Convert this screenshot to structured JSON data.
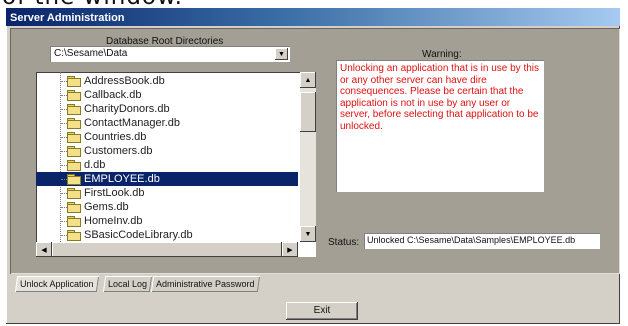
{
  "caption_overflow": "of the window.",
  "window": {
    "title": "Server Administration"
  },
  "db_roots": {
    "label": "Database Root Directories",
    "selected": "C:\\Sesame\\Data"
  },
  "tree": {
    "items": [
      {
        "label": "AddressBook.db",
        "selected": false
      },
      {
        "label": "Callback.db",
        "selected": false
      },
      {
        "label": "CharityDonors.db",
        "selected": false
      },
      {
        "label": "ContactManager.db",
        "selected": false
      },
      {
        "label": "Countries.db",
        "selected": false
      },
      {
        "label": "Customers.db",
        "selected": false
      },
      {
        "label": "d.db",
        "selected": false
      },
      {
        "label": "EMPLOYEE.db",
        "selected": true
      },
      {
        "label": "FirstLook.db",
        "selected": false
      },
      {
        "label": "Gems.db",
        "selected": false
      },
      {
        "label": "HomeInv.db",
        "selected": false
      },
      {
        "label": "SBasicCodeLibrary.db",
        "selected": false
      }
    ]
  },
  "warning": {
    "label": "Warning:",
    "text": "Unlocking an application that is in use by this or any other server can have dire consequences. Please be certain that the application is not in use by any user or server, before selecting that application to be unlocked."
  },
  "status": {
    "label": "Status:",
    "value": "Unlocked C:\\Sesame\\Data\\Samples\\EMPLOYEE.db"
  },
  "tabs": [
    {
      "label": "Unlock Application",
      "active": true
    },
    {
      "label": "Local Log",
      "active": false
    },
    {
      "label": "Administrative Password",
      "active": false
    }
  ],
  "exit_label": "Exit",
  "colors": {
    "title_start": "#0a246a",
    "selection": "#0a246a",
    "warning_text": "#e01010",
    "panel": "#a49f94"
  }
}
